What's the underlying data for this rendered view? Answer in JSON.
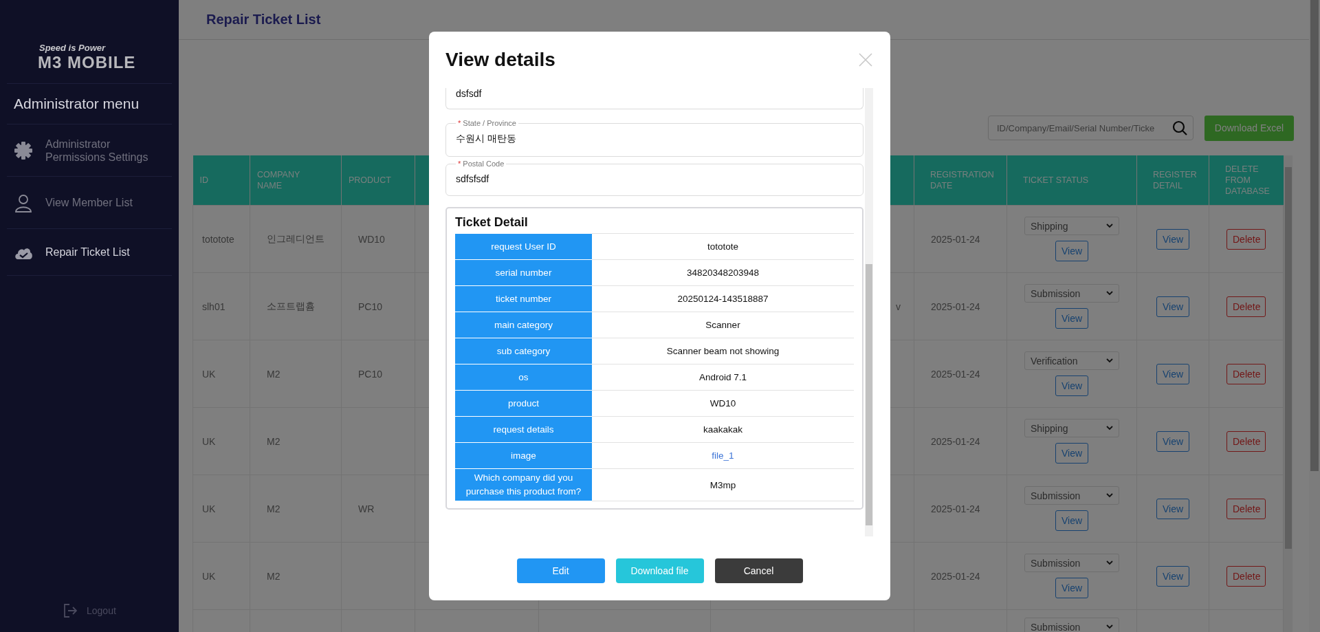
{
  "sidebar": {
    "logo": {
      "tagline": "Speed is Power",
      "name": "M3 MOBILE"
    },
    "menu_title": "Administrator menu",
    "items": [
      {
        "label": "Administrator Permissions Settings",
        "selected": false
      },
      {
        "label": "View Member List",
        "selected": false
      },
      {
        "label": "Repair Ticket List",
        "selected": true
      }
    ],
    "logout": "Logout"
  },
  "page": {
    "title": "Repair Ticket List"
  },
  "search": {
    "placeholder": "ID/Company/Email/Serial Number/Ticke"
  },
  "download_excel": "Download Excel",
  "table": {
    "columns": [
      "ID",
      "COMPANY NAME",
      "PRODUCT",
      "REGISTRATION DATE",
      "TICKET STATUS",
      "REGISTER DETAIL",
      "DELETE FROM DATABASE"
    ],
    "rows": [
      {
        "id": "tototote",
        "company": "인그레디언트",
        "product": "WD10",
        "registration_date": "2025-01-24",
        "ticket_status": "Shipping",
        "status_button": "View",
        "detail_button": "View",
        "delete_button": "Delete"
      },
      {
        "id": "slh01",
        "company": "소프트랩흄",
        "product": "PC10",
        "column_6": "v",
        "registration_date": "2025-01-24",
        "ticket_status": "Submission",
        "status_button": "View",
        "detail_button": "View",
        "delete_button": "Delete"
      },
      {
        "id": "UK",
        "company": "M2",
        "product": "PC10",
        "registration_date": "2025-01-24",
        "ticket_status": "Verification",
        "status_button": "View",
        "detail_button": "View",
        "delete_button": "Delete"
      },
      {
        "id": "UK",
        "company": "M2",
        "registration_date": "2025-01-24",
        "ticket_status": "Shipping",
        "status_button": "View",
        "detail_button": "View",
        "delete_button": "Delete"
      },
      {
        "id": "UK",
        "company": "M2",
        "product": "WR",
        "registration_date": "2025-01-24",
        "ticket_status": "Submission",
        "status_button": "View",
        "detail_button": "View",
        "delete_button": "Delete"
      },
      {
        "id": "UK",
        "company": "M2",
        "registration_date": "2025-01-24",
        "ticket_status": "Submission",
        "status_button": "View",
        "detail_button": "View",
        "delete_button": "Delete"
      },
      {
        "ticket_status": "Submission"
      }
    ]
  },
  "modal": {
    "title": "View details",
    "fields": [
      {
        "value": "dsfsdf",
        "cut": true
      },
      {
        "label": "State / Province",
        "required_mark": "*",
        "value": "수원시 매탄동",
        "cut": false
      },
      {
        "label": "Postal Code",
        "required_mark": "*",
        "value": "sdfsfsdf",
        "cut": false
      }
    ],
    "ticket_detail": {
      "title": "Ticket Detail",
      "rows": [
        {
          "label": "request User ID",
          "value": "tototote",
          "kind": "text"
        },
        {
          "label": "serial number",
          "value": "34820348203948",
          "kind": "text"
        },
        {
          "label": "ticket number",
          "value": "20250124-143518887",
          "kind": "text"
        },
        {
          "label": "main category",
          "value": "Scanner",
          "kind": "text"
        },
        {
          "label": "sub category",
          "value": "Scanner beam not showing",
          "kind": "text"
        },
        {
          "label": "os",
          "value": "Android 7.1",
          "kind": "text"
        },
        {
          "label": "product",
          "value": "WD10",
          "kind": "text"
        },
        {
          "label": "request details",
          "value": "kaakakak",
          "kind": "text"
        },
        {
          "label": "image",
          "value": "file_1",
          "kind": "link"
        },
        {
          "label": "Which company did you purchase this product from?",
          "value": "M3mp",
          "kind": "text"
        }
      ]
    },
    "buttons": [
      {
        "label": "Edit",
        "kind": "primary"
      },
      {
        "label": "Download file",
        "kind": "info"
      },
      {
        "label": "Cancel",
        "kind": "dark"
      }
    ]
  }
}
